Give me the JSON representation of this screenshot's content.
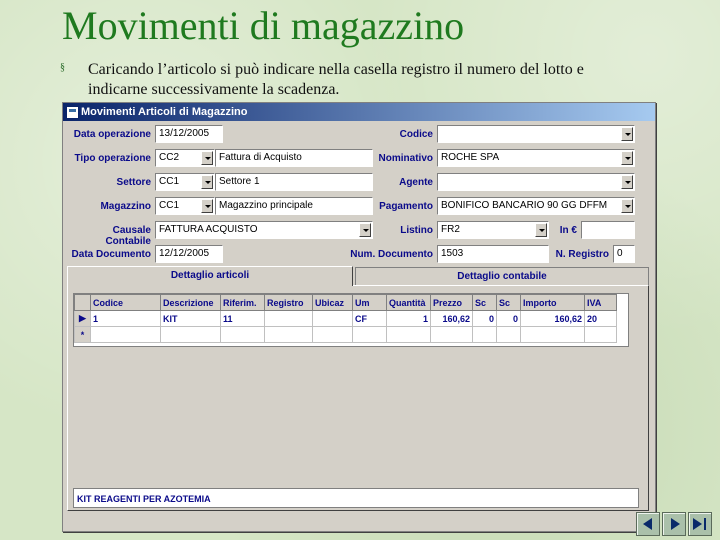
{
  "slide": {
    "title": "Movimenti di magazzino",
    "bullet_line1": "Caricando l’articolo si può indicare nella casella registro il numero del lotto e",
    "bullet_line2": "indicarne successivamente la scadenza."
  },
  "window": {
    "title": "Movimenti Articoli di Magazzino"
  },
  "form": {
    "data_operazione": {
      "label": "Data operazione",
      "value": "13/12/2005"
    },
    "tipo_operazione": {
      "label": "Tipo operazione",
      "code": "CC2",
      "desc": "Fattura di Acquisto"
    },
    "settore": {
      "label": "Settore",
      "code": "CC1",
      "desc": "Settore 1"
    },
    "magazzino": {
      "label": "Magazzino",
      "code": "CC1",
      "desc": "Magazzino principale"
    },
    "causale": {
      "label": "Causale Contabile",
      "value": "FATTURA ACQUISTO"
    },
    "data_documento": {
      "label": "Data Documento",
      "value": "12/12/2005"
    },
    "codice": {
      "label": "Codice",
      "value": ""
    },
    "nominativo": {
      "label": "Nominativo",
      "value": "ROCHE SPA"
    },
    "agente": {
      "label": "Agente",
      "value": ""
    },
    "pagamento": {
      "label": "Pagamento",
      "value": "BONIFICO BANCARIO 90 GG DFFM"
    },
    "listino": {
      "label": "Listino",
      "value": "FR2"
    },
    "in_euro": {
      "label": "In €",
      "value": ""
    },
    "num_documento": {
      "label": "Num. Documento",
      "value": "1503"
    },
    "n_registro": {
      "label": "N. Registro",
      "value": "0"
    }
  },
  "tabs": {
    "dettaglio_articoli": "Dettaglio articoli",
    "dettaglio_contabile": "Dettaglio contabile"
  },
  "grid": {
    "columns": [
      "Codice",
      "Descrizione",
      "Riferim.",
      "Registro",
      "Ubicaz",
      "Um",
      "Quantità",
      "Prezzo",
      "Sc",
      "Sc",
      "Importo",
      "IVA"
    ],
    "rows": [
      {
        "selector": "▶",
        "cells": [
          "1",
          "KIT",
          "11",
          "",
          "",
          "CF",
          "1",
          "160,62",
          "0",
          "0",
          "160,62",
          "20"
        ]
      },
      {
        "selector": "*",
        "cells": [
          "",
          "",
          "",
          "",
          "",
          "",
          "",
          "",
          "",
          "",
          "",
          ""
        ]
      }
    ]
  },
  "memo": "KIT REAGENTI PER AZOTEMIA",
  "colors": {
    "title": "#1f7a1f",
    "label": "#0a0a8a",
    "background": "#d6e6c6"
  }
}
